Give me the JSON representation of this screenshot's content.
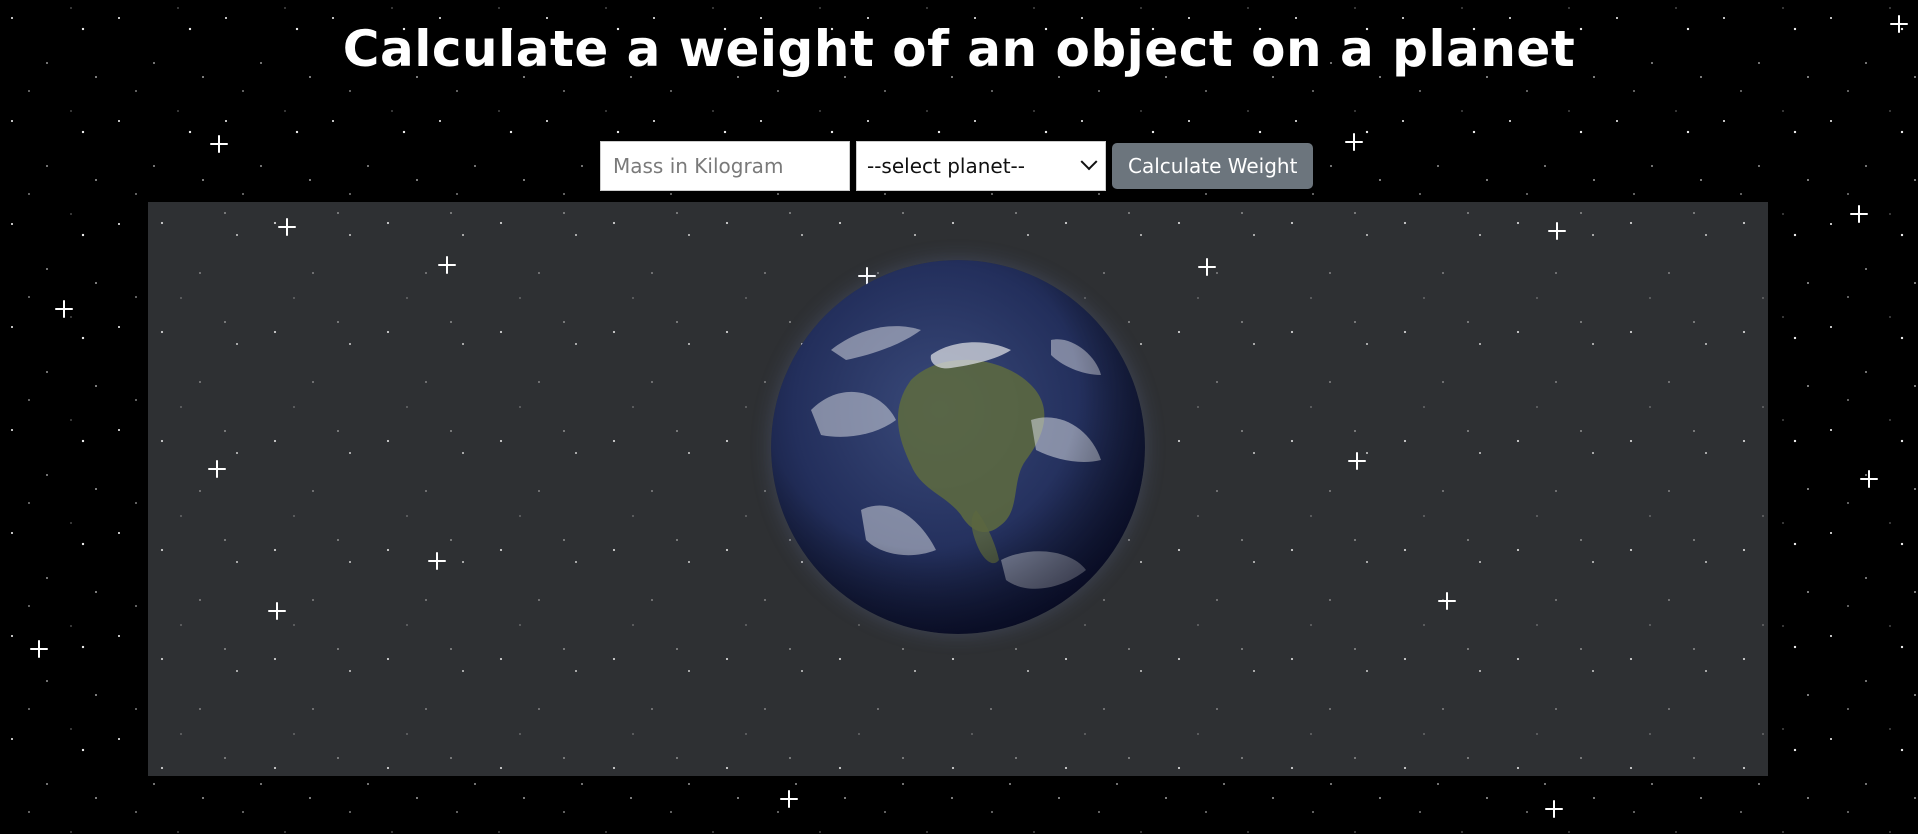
{
  "header": {
    "title": "Calculate a weight of an object on a planet"
  },
  "form": {
    "mass_placeholder": "Mass in Kilogram",
    "mass_value": "",
    "planet_select_value": "--select planet--",
    "calculate_label": "Calculate Weight"
  },
  "display": {
    "planet_image": "earth",
    "background": "starfield"
  },
  "colors": {
    "page_background": "#000000",
    "panel_background": "#2e3033",
    "button_background": "#6c757d",
    "title_color": "#ffffff"
  }
}
